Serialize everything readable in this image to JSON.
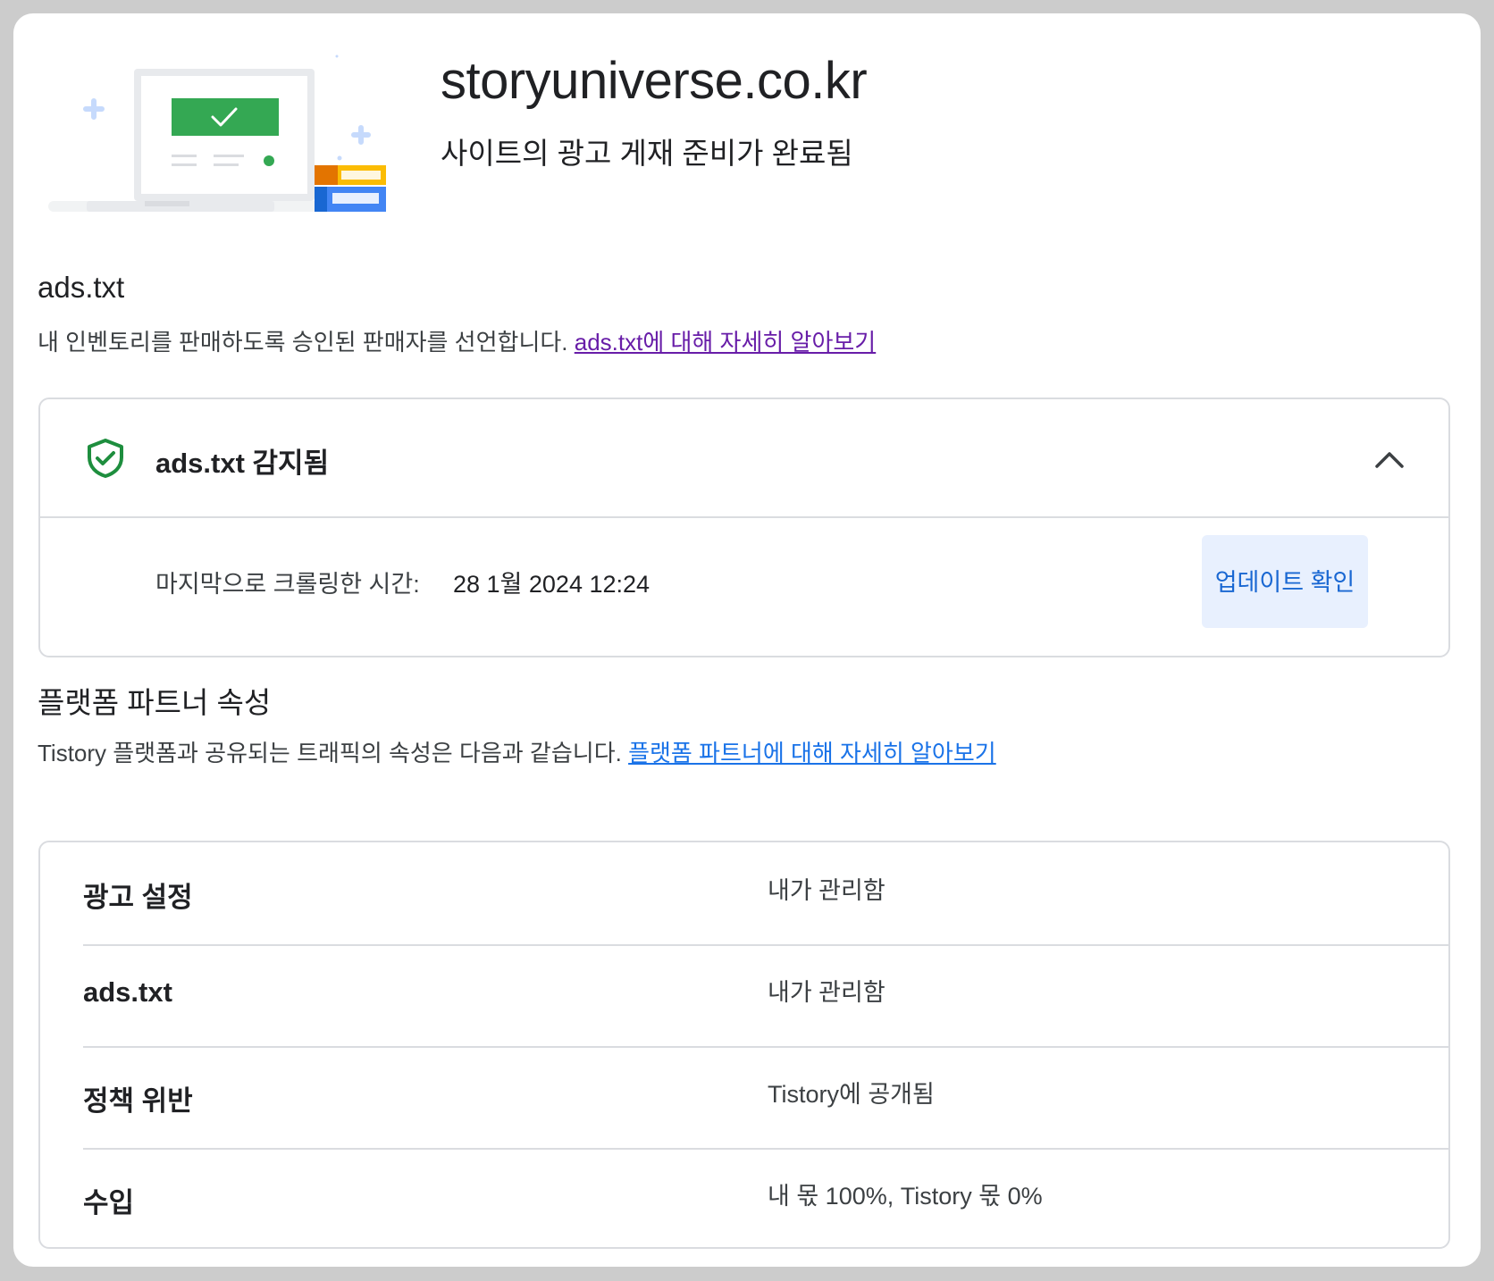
{
  "header": {
    "site_name": "storyuniverse.co.kr",
    "status": "사이트의 광고 게재 준비가 완료됨"
  },
  "ads_txt_section": {
    "heading": "ads.txt",
    "description": "내 인벤토리를 판매하도록 승인된 판매자를 선언합니다.",
    "learn_more_link": "ads.txt에 대해 자세히 알아보기",
    "panel": {
      "title": "ads.txt 감지됨",
      "crawl_label": "마지막으로 크롤링한 시간:",
      "crawl_value": "28 1월 2024 12:24",
      "update_button": "업데이트 확인"
    }
  },
  "partner_section": {
    "heading": "플랫폼 파트너 속성",
    "description": "Tistory 플랫폼과 공유되는 트래픽의 속성은 다음과 같습니다.",
    "learn_more_link": "플랫폼 파트너에 대해 자세히 알아보기",
    "properties": [
      {
        "label": "광고 설정",
        "value": "내가 관리함"
      },
      {
        "label": "ads.txt",
        "value": "내가 관리함"
      },
      {
        "label": "정책 위반",
        "value": "Tistory에 공개됨"
      },
      {
        "label": "수입",
        "value": "내 몫 100%, Tistory 몫 0%"
      }
    ]
  },
  "icons": {
    "hero": "laptop-check-illustration",
    "ads_status": "shield-check-icon",
    "collapse": "chevron-up-icon"
  },
  "colors": {
    "success_green": "#34a853",
    "shield_green": "#1e8e3e",
    "link_visited": "#681da8",
    "link_blue": "#1a73e8",
    "button_bg": "#e8f0fe",
    "button_text": "#1967d2"
  }
}
